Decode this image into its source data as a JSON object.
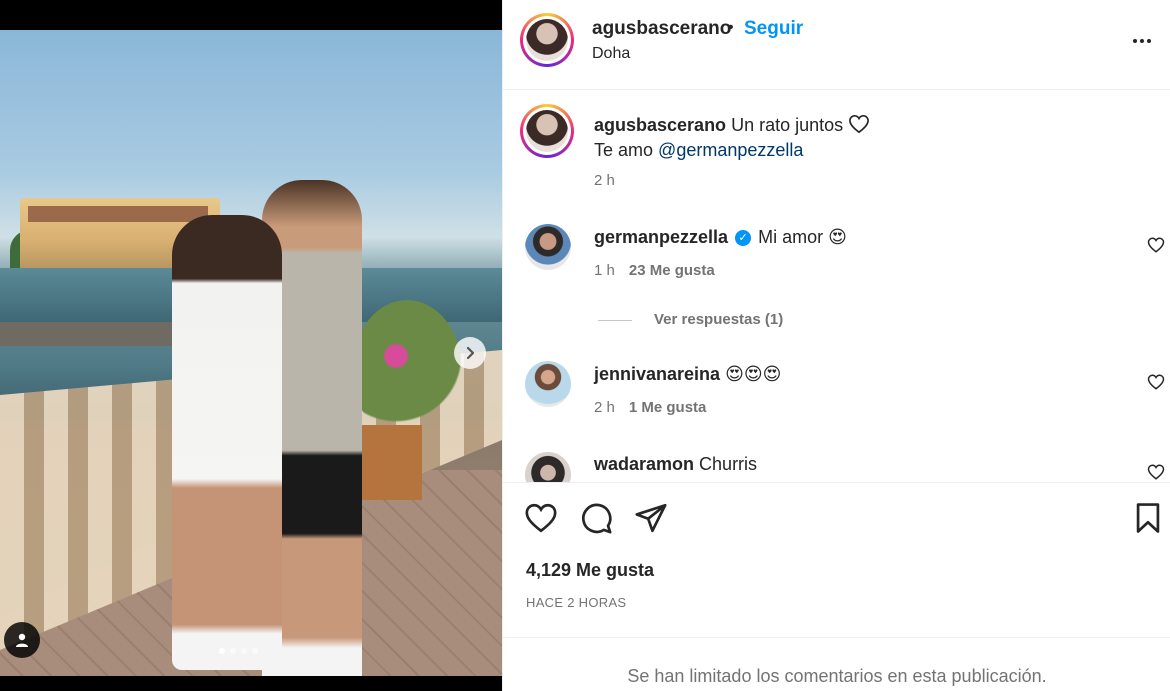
{
  "post": {
    "author": "agusbascerano",
    "separator": "•",
    "follow_label": "Seguir",
    "location": "Doha",
    "more_label": "more-options"
  },
  "carousel": {
    "total": 4,
    "active": 1
  },
  "caption": {
    "username": "agusbascerano",
    "text": "Un rato juntos",
    "line2_prefix": "Te amo",
    "mention": "@germanpezzella",
    "time": "2 h"
  },
  "comments": [
    {
      "username": "germanpezzella",
      "text": "Mi amor",
      "emoji": "😍",
      "time": "1 h",
      "likes": "23 Me gusta",
      "verified": "✓"
    },
    {
      "username": "jennivanareina",
      "text": "",
      "emoji": "😍😍😍",
      "time": "2 h",
      "likes": "1 Me gusta"
    },
    {
      "username": "wadaramon",
      "text": "Churris"
    }
  ],
  "replies_label": "Ver respuestas (1)",
  "likes_count": "4,129 Me gusta",
  "timestamp": "HACE 2 HORAS",
  "comments_limited": "Se han limitado los comentarios en esta publicación.",
  "colors": {
    "accent": "#0095f6",
    "text": "#262626",
    "secondary": "#737373",
    "mention": "#00376b"
  }
}
